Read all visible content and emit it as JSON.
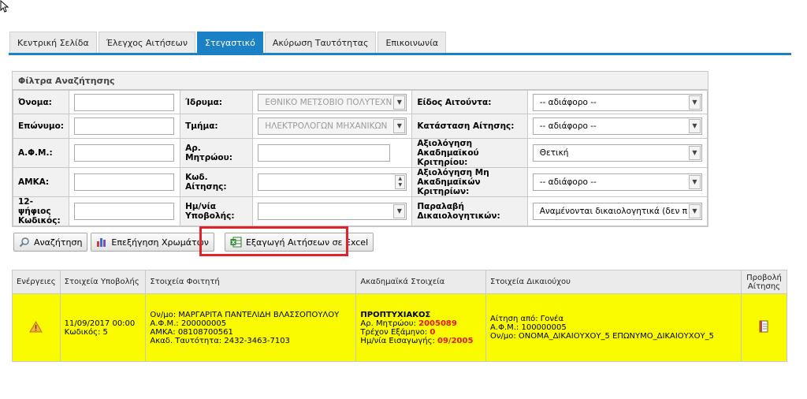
{
  "tabs": [
    {
      "label": "Κεντρική Σελίδα",
      "active": false
    },
    {
      "label": "Έλεγχος Αιτήσεων",
      "active": false
    },
    {
      "label": "Στεγαστικό",
      "active": true
    },
    {
      "label": "Ακύρωση Ταυτότητας",
      "active": false
    },
    {
      "label": "Επικοινωνία",
      "active": false
    }
  ],
  "accent_color": "#1b80c4",
  "filters": {
    "title": "Φίλτρα Αναζήτησης",
    "name_label": "Όνομα:",
    "surname_label": "Επώνυμο:",
    "afm_label": "Α.Φ.Μ.:",
    "amka_label": "ΑΜΚΑ:",
    "code12_label": "12-ψήφιος Κωδικός:",
    "institution_label": "Ίδρυμα:",
    "institution_value": "ΕΘΝΙΚΟ ΜΕΤΣΟΒΙΟ ΠΟΛΥΤΕΧΝ",
    "department_label": "Τμήμα:",
    "department_value": "ΗΛΕΚΤΡΟΛΟΓΩΝ ΜΗΧΑΝΙΚΩΝ",
    "registry_label": "Αρ. Μητρώου:",
    "app_code_label": "Κωδ. Αίτησης:",
    "submit_date_label": "Ημ/νία Υποβολής:",
    "applicant_type_label": "Είδος Αιτούντα:",
    "applicant_type_value": "-- αδιάφορο --",
    "status_label": "Κατάσταση Αίτησης:",
    "status_value": "-- αδιάφορο --",
    "academic_eval_label": "Αξιολόγηση Ακαδημαϊκού Κριτηρίου:",
    "academic_eval_value": "Θετική",
    "nonacademic_eval_label": "Αξιολόγηση Μη Ακαδημαϊκών Κριτηρίων:",
    "nonacademic_eval_value": "-- αδιάφορο --",
    "docs_label": "Παραλαβή Δικαιολογητικών:",
    "docs_value": "Αναμένονται δικαιολογητικά (δεν π"
  },
  "buttons": {
    "search": "Αναζήτηση",
    "colors": "Επεξήγηση Χρωμάτων",
    "export": "Εξαγωγή Αιτήσεων σε Excel"
  },
  "table": {
    "headers": {
      "actions": "Ενέργειες",
      "submission": "Στοιχεία Υποβολής",
      "student": "Στοιχεία Φοιτητή",
      "academic": "Ακαδημαϊκά Στοιχεία",
      "beneficiary": "Στοιχεία Δικαιούχου",
      "view": "Προβολή Αίτησης"
    },
    "row": {
      "submit_date": "11/09/2017 00:00",
      "code": "Κωδικός: 5",
      "student_name": "Ον/μο: ΜΑΡΓΑΡΙΤΑ ΠΑΝΤΕΛΙΔΗ ΒΛΑΣΣΟΠΟΥΛΟΥ",
      "student_afm": "Α.Φ.Μ.: 200000005",
      "student_amka": "ΑΜΚΑ: 08108700561",
      "student_id": "Ακαδ. Ταυτότητα: 2432-3463-7103",
      "level": "ΠΡΟΠΤΥΧΙΑΚΟΣ",
      "registry_label": "Αρ. Μητρώου: ",
      "registry_value": "2005089",
      "semester_label": "Τρέχον Εξάμηνο: ",
      "semester_value": "0",
      "entry_label": "Ημ/νία Εισαγωγής: ",
      "entry_value": "09/2005",
      "ben_applicant": "Αίτηση από: Γονέα",
      "ben_afm": "Α.Φ.Μ.: 100000005",
      "ben_name": "Ον/μο: ΟΝΟΜΑ_ΔΙΚΑΙΟΥΧΟΥ_5 ΕΠΩΝΥΜΟ_ΔΙΚΑΙΟΥΧΟΥ_5"
    },
    "row_color": "#fbfb00"
  }
}
